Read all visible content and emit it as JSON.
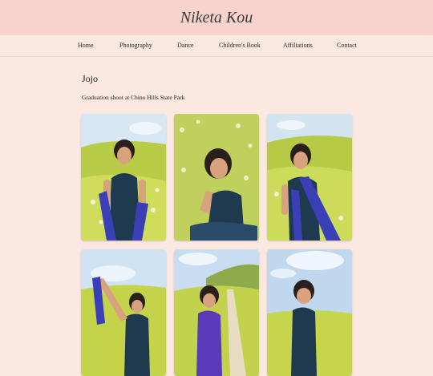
{
  "site": {
    "title": "Niketa Kou"
  },
  "nav": {
    "items": [
      {
        "label": "Home"
      },
      {
        "label": "Photography"
      },
      {
        "label": "Dance"
      },
      {
        "label": "Children's Book"
      },
      {
        "label": "Affiliations"
      },
      {
        "label": "Contact"
      }
    ]
  },
  "page": {
    "title": "Jojo",
    "subtitle": "Graduation shoot at Chino Hills State Park"
  },
  "colors": {
    "banner": "#f7d3cb",
    "background": "#fbe8e1",
    "stole": "#3a3fb8",
    "dress": "#1f3a4f",
    "hill": "#c4d44a",
    "sky": "#cfe3f2"
  }
}
